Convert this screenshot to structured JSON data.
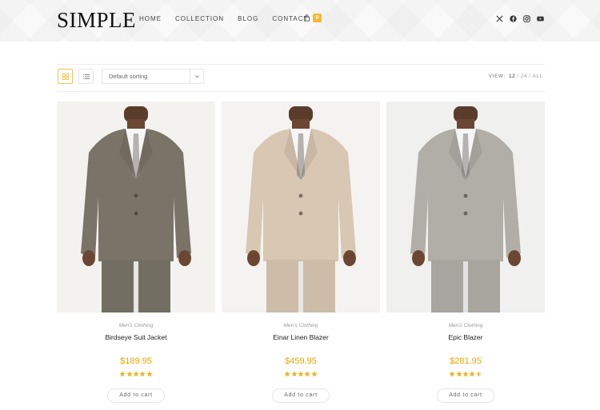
{
  "site": {
    "logo": "SIMPLE"
  },
  "nav": [
    "HOME",
    "COLLECTION",
    "BLOG",
    "CONTACT"
  ],
  "cart": {
    "count": "0"
  },
  "social": [
    "x-icon",
    "facebook-icon",
    "instagram-icon",
    "youtube-icon"
  ],
  "toolbar": {
    "sort_value": "Default sorting",
    "view_label": "VIEW:",
    "view_options": [
      "12",
      "24",
      "ALL"
    ],
    "view_selected": "12"
  },
  "colors": {
    "accent": "#f7b731",
    "price": "#f0a500",
    "star": "#f0b323"
  },
  "products": [
    {
      "category": "Men's Clothing",
      "title": "Birdseye Suit Jacket",
      "price": "$189.95",
      "rating": 5,
      "button": "Add to cart",
      "suit_color": "#7a7468"
    },
    {
      "category": "Men's Clothing",
      "title": "Einar Linen Blazer",
      "price": "$459.95",
      "rating": 5,
      "button": "Add to cart",
      "suit_color": "#d8c7b2"
    },
    {
      "category": "Men's Clothing",
      "title": "Epic Blazer",
      "price": "$281.95",
      "rating": 4.5,
      "button": "Add to cart",
      "suit_color": "#b1aea8"
    }
  ]
}
